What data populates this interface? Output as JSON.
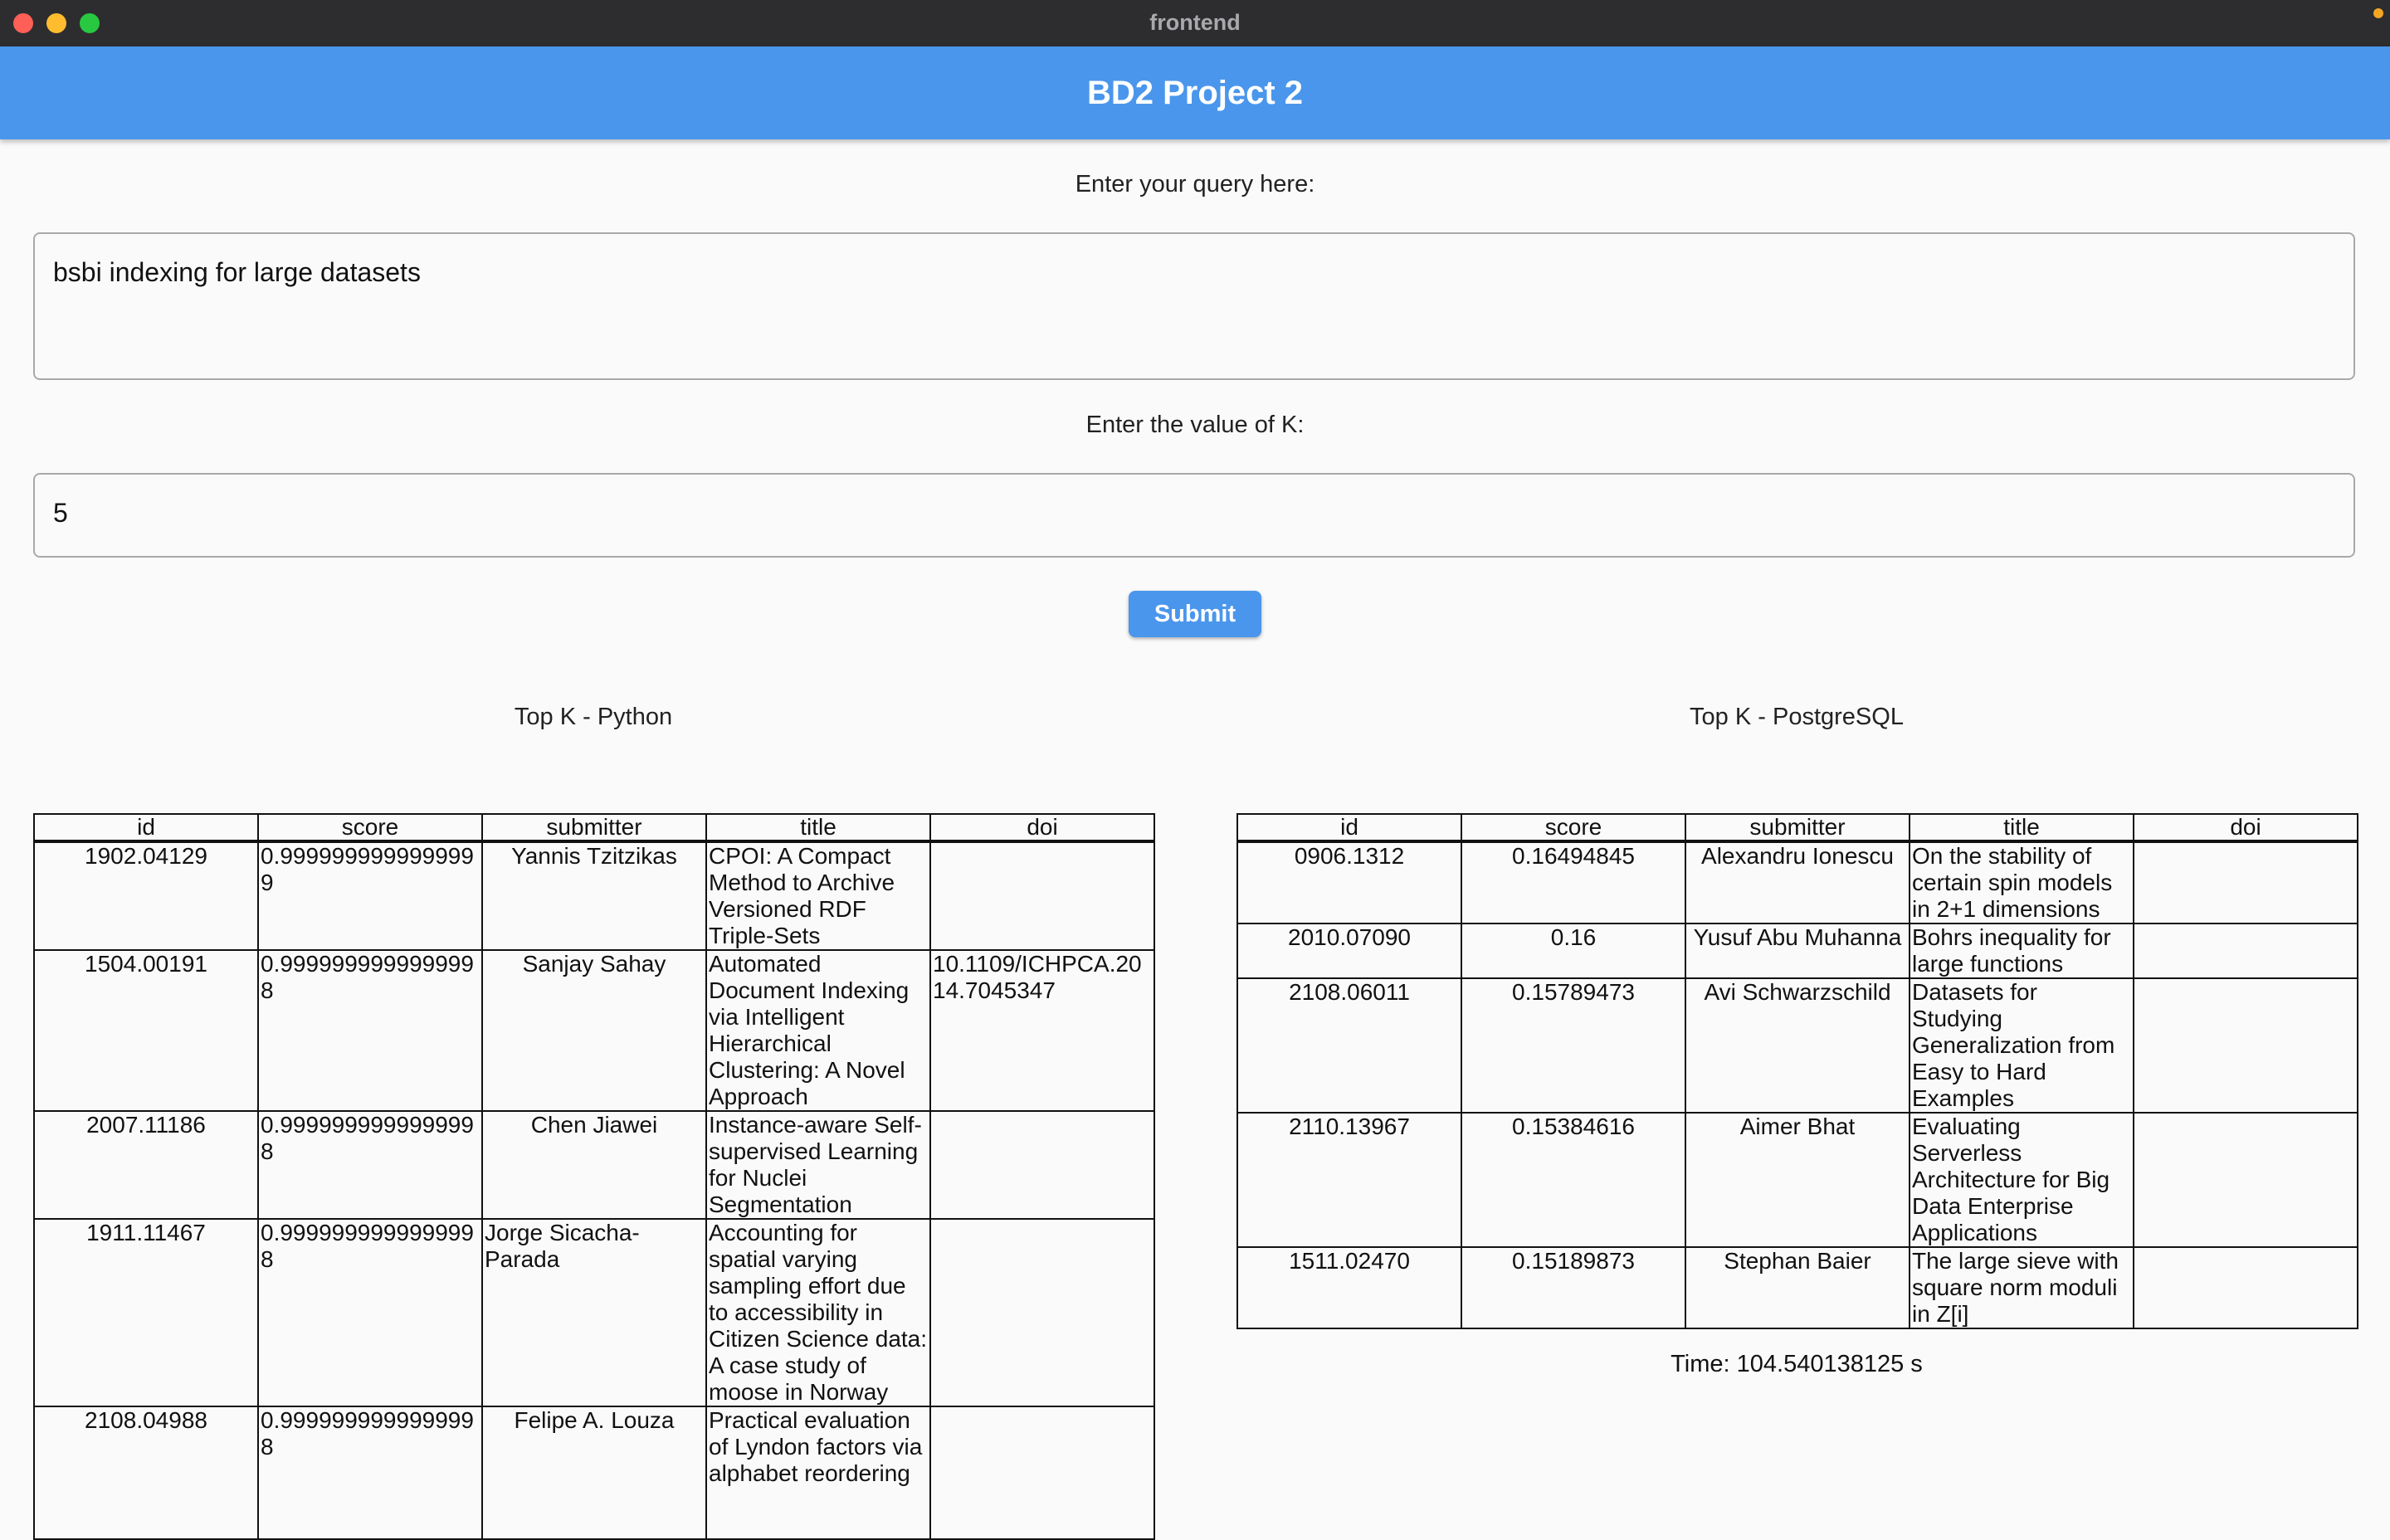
{
  "window": {
    "title": "frontend"
  },
  "appbar": {
    "title": "BD2 Project 2"
  },
  "query": {
    "label": "Enter your query here:",
    "value": "bsbi indexing for large datasets"
  },
  "k": {
    "label": "Enter the value of K:",
    "value": "5"
  },
  "submit": {
    "label": "Submit"
  },
  "python": {
    "title": "Top K - Python",
    "columns": [
      "id",
      "score",
      "submitter",
      "title",
      "doi"
    ],
    "rows": [
      [
        "1902.04129",
        "0.9999999999999999",
        "Yannis Tzitzikas",
        "CPOI: A Compact Method to Archive Versioned RDF Triple-Sets",
        ""
      ],
      [
        "1504.00191",
        "0.9999999999999998",
        "Sanjay Sahay",
        "Automated Document Indexing via Intelligent Hierarchical Clustering: A  Novel Approach",
        "10.1109/ICHPCA.2014.7045347"
      ],
      [
        "2007.11186",
        "0.9999999999999998",
        "Chen Jiawei",
        "Instance-aware Self-supervised Learning for Nuclei Segmentation",
        ""
      ],
      [
        "1911.11467",
        "0.9999999999999998",
        "Jorge Sicacha-Parada",
        "Accounting for spatial varying sampling effort due to accessibility in  Citizen Science data: A case study of moose in Norway",
        ""
      ],
      [
        "2108.04988",
        "0.9999999999999998",
        "Felipe A. Louza",
        "Practical evaluation of Lyndon factors via alphabet reordering",
        ""
      ]
    ]
  },
  "postgres": {
    "title": "Top K - PostgreSQL",
    "columns": [
      "id",
      "score",
      "submitter",
      "title",
      "doi"
    ],
    "rows": [
      [
        "0906.1312",
        "0.16494845",
        "Alexandru Ionescu",
        "On the stability of certain spin models in 2+1 dimensions",
        ""
      ],
      [
        "2010.07090",
        "0.16",
        "Yusuf Abu Muhanna",
        "Bohrs inequality for large functions",
        ""
      ],
      [
        "2108.06011",
        "0.15789473",
        "Avi Schwarzschild",
        "Datasets for Studying Generalization from Easy to Hard Examples",
        ""
      ],
      [
        "2110.13967",
        "0.15384616",
        "Aimer Bhat",
        "Evaluating Serverless Architecture for Big Data Enterprise Applications",
        ""
      ],
      [
        "1511.02470",
        "0.15189873",
        "Stephan Baier",
        "The large sieve with square norm moduli in Z[i]",
        ""
      ]
    ],
    "time": "Time: 104.540138125 s"
  }
}
